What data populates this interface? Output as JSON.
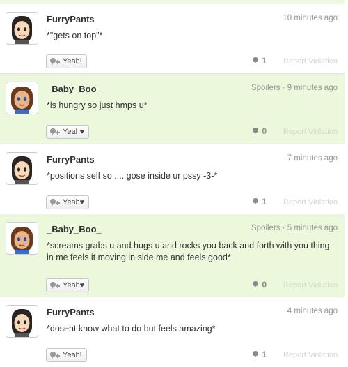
{
  "posts": [
    {
      "username": "FurryPants",
      "meta": "10 minutes ago",
      "body": "*\"gets on top\"*",
      "yeah_label": "Yeah!",
      "yeah_count": "1",
      "report_label": "Report Violation",
      "spoiler": false,
      "avatar": "furrypants"
    },
    {
      "username": "_Baby_Boo_",
      "meta": "Spoilers · 9 minutes ago",
      "body": "*is hungry so just hmps u*",
      "yeah_label": "Yeah♥",
      "yeah_count": "0",
      "report_label": "Report Violation",
      "spoiler": true,
      "avatar": "babyboo"
    },
    {
      "username": "FurryPants",
      "meta": "7 minutes ago",
      "body": "*positions self so .... gose inside ur pssy -3-*",
      "yeah_label": "Yeah♥",
      "yeah_count": "1",
      "report_label": "Report Violation",
      "spoiler": false,
      "avatar": "furrypants"
    },
    {
      "username": "_Baby_Boo_",
      "meta": "Spoilers · 5 minutes ago",
      "body": "*screams grabs u and hugs u and rocks you back and forth with you thing in me feels it moving in side me and feels good*",
      "yeah_label": "Yeah♥",
      "yeah_count": "0",
      "report_label": "Report Violation",
      "spoiler": true,
      "avatar": "babyboo"
    },
    {
      "username": "FurryPants",
      "meta": "4 minutes ago",
      "body": "*dosent know what to do but feels amazing*",
      "yeah_label": "Yeah!",
      "yeah_count": "1",
      "report_label": "Report Violation",
      "spoiler": false,
      "avatar": "furrypants"
    }
  ],
  "colors": {
    "spoiler_background": "#ebf8dc",
    "meta_text": "#969696",
    "report_text": "#d5d5d5",
    "divider": "#e3e3e3"
  },
  "icons": {
    "yeah_button": "yeah-plus-icon",
    "yeah_count": "yeah-bubble-icon"
  }
}
